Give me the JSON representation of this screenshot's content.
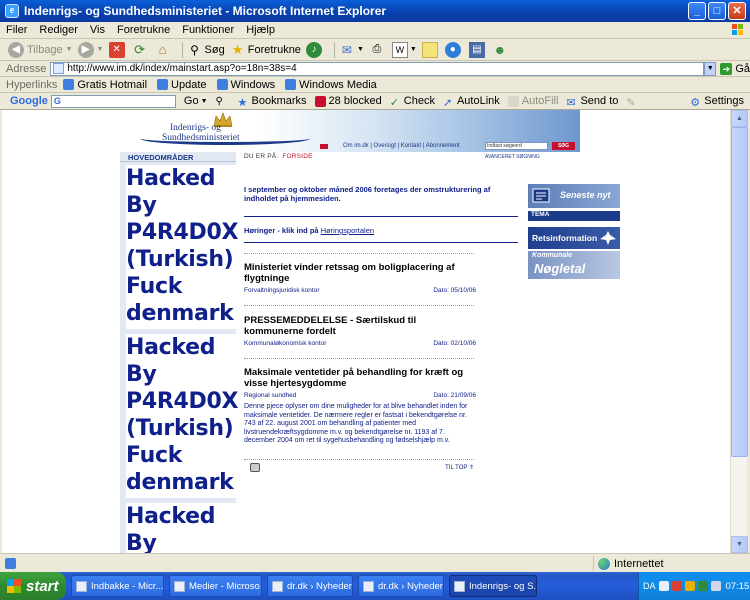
{
  "window": {
    "title": "Indenrigs- og Sundhedsministeriet - Microsoft Internet Explorer",
    "icon": "ie-icon"
  },
  "menu": [
    "Filer",
    "Rediger",
    "Vis",
    "Foretrukne",
    "Funktioner",
    "Hjælp"
  ],
  "toolbar": {
    "back": "Tilbage",
    "search": "Søg",
    "favorites": "Foretrukne"
  },
  "address": {
    "label": "Adresse",
    "url": "http://www.im.dk/index/mainstart.asp?o=18n=38s=4",
    "go": "Gå"
  },
  "links_bar": {
    "label": "Hyperlinks",
    "items": [
      "Gratis Hotmail",
      "Update",
      "Windows",
      "Windows Media"
    ]
  },
  "google_bar": {
    "logo": "Google",
    "search_value": "G",
    "go": "Go",
    "bookmarks": "Bookmarks",
    "blocked": "28 blocked",
    "check": "Check",
    "autolink": "AutoLink",
    "autofill": "AutoFill",
    "sendto": "Send to",
    "settings": "Settings"
  },
  "site": {
    "logo_line1": "Indenrigs- og",
    "logo_line2": "Sundhedsministeriet",
    "top_links": "Om im.dk | Oversigt | Kontakt | Abonnement",
    "search_placeholder": "Indtast søgeord",
    "search_button": "SØG",
    "advanced_search": "AVANCERET SØGNING",
    "left_header": "HOVEDOMRÅDER",
    "defacement_text": "Hacked By P4R4D0X (Turkish) Fuck denmark",
    "defacement_text_3": "Hacked By",
    "breadcrumb_prefix": "DU ER PÅ:",
    "breadcrumb_page": "FORSIDE",
    "intro": "I september og oktober måned 2006 foretages der omstrukturering af indholdet på hjemmesiden.",
    "hearing_text": "Høringer - klik ind på ",
    "hearing_link": "Høringsportalen",
    "news": [
      {
        "title": "Ministeriet vinder retssag om boligplacering af flygtninge",
        "dept": "Forvaltningsjuridisk kontor",
        "date": "Dato: 05/10/06",
        "body": ""
      },
      {
        "title": "PRESSEMEDDELELSE - Særtilskud til kommunerne fordelt",
        "dept": "Kommunaløkonomisk kontor",
        "date": "Dato: 02/10/06",
        "body": ""
      },
      {
        "title": "Maksimale ventetider på behandling for kræft og visse hjertesygdomme",
        "dept": "Regional sundhed",
        "date": "Dato: 21/09/06",
        "body": "Denne pjece oplyser om dine muligheder for at blive behandlet inden for maksimale ventetider. De nærmere regler er fastsat i bekendtgørelse nr. 743 af 22. august 2001 om behandling af patienter med livstruendekræftsygdomme m.v. og bekendtgørelse nr. 1193 af 7. december 2004 om ret til sygehusbehandling og fødselshjælp m.v."
      }
    ],
    "to_top": "TIL TOP",
    "right_boxes": [
      "Seneste nyt",
      "TEMA",
      "Retsinformation",
      "Kommunale",
      "Nøgletal"
    ]
  },
  "status": {
    "zone": "Internettet"
  },
  "taskbar": {
    "start": "start",
    "buttons": [
      "Indbakke - Micr...",
      "Medier - Microso...",
      "dr.dk › Nyheder...",
      "dr.dk › Nyheder...",
      "Indenrigs- og S..."
    ],
    "lang": "DA",
    "clock": "07:15"
  }
}
